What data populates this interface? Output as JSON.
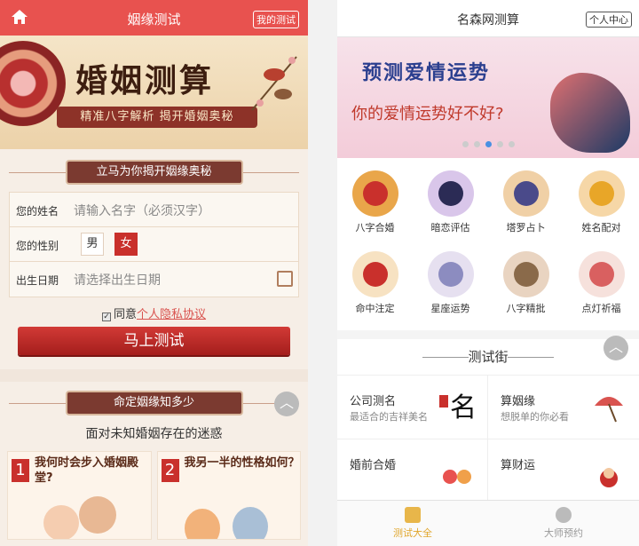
{
  "left": {
    "header": {
      "title": "姻缘测试",
      "my_test": "我的测试"
    },
    "banner": {
      "title": "婚姻测算",
      "ribbon": "精准八字解析 揭开婚姻奥秘"
    },
    "badge": "立马为你揭开姻缘奥秘",
    "form": {
      "name_label": "您的姓名",
      "name_placeholder": "请输入名字（必须汉字）",
      "gender_label": "您的性别",
      "male": "男",
      "female": "女",
      "birth_label": "出生日期",
      "birth_placeholder": "请选择出生日期"
    },
    "agree_text": "同意",
    "agree_link": "个人隐私协议",
    "submit": "马上测试",
    "section2_badge": "命定姻缘知多少",
    "section2_sub": "面对未知婚姻存在的迷惑",
    "cards": [
      {
        "num": "1",
        "text": "我何时会步入婚姻殿堂?"
      },
      {
        "num": "2",
        "text": "我另一半的性格如何？"
      }
    ]
  },
  "right": {
    "header": {
      "title": "名森网测算",
      "user_center": "个人中心"
    },
    "banner": {
      "title": "预测爱情运势",
      "subtitle": "你的爱情运势好不好?"
    },
    "grid": [
      {
        "label": "八字合婚",
        "color": "#e9a64a",
        "inner": "#c9302c"
      },
      {
        "label": "暗恋评估",
        "color": "#d9c6ea",
        "inner": "#2b2b55"
      },
      {
        "label": "塔罗占卜",
        "color": "#f0d0a6",
        "inner": "#4a4a8a"
      },
      {
        "label": "姓名配对",
        "color": "#f6d7a7",
        "inner": "#e8a628"
      },
      {
        "label": "命中注定",
        "color": "#f7e2c2",
        "inner": "#c9302c"
      },
      {
        "label": "星座运势",
        "color": "#e6e0f0",
        "inner": "#8c8cc0"
      },
      {
        "label": "八字精批",
        "color": "#e9d4c1",
        "inner": "#8a6a4a"
      },
      {
        "label": "点灯祈福",
        "color": "#f6e1dc",
        "inner": "#d96060"
      }
    ],
    "street_title": "测试街",
    "street": [
      {
        "name": "公司测名",
        "desc": "最适合的吉祥美名"
      },
      {
        "name": "算姻缘",
        "desc": "想脱单的你必看"
      },
      {
        "name": "婚前合婚",
        "desc": ""
      },
      {
        "name": "算财运",
        "desc": ""
      }
    ],
    "tabs": [
      {
        "label": "测试大全"
      },
      {
        "label": "大师预约"
      }
    ]
  }
}
